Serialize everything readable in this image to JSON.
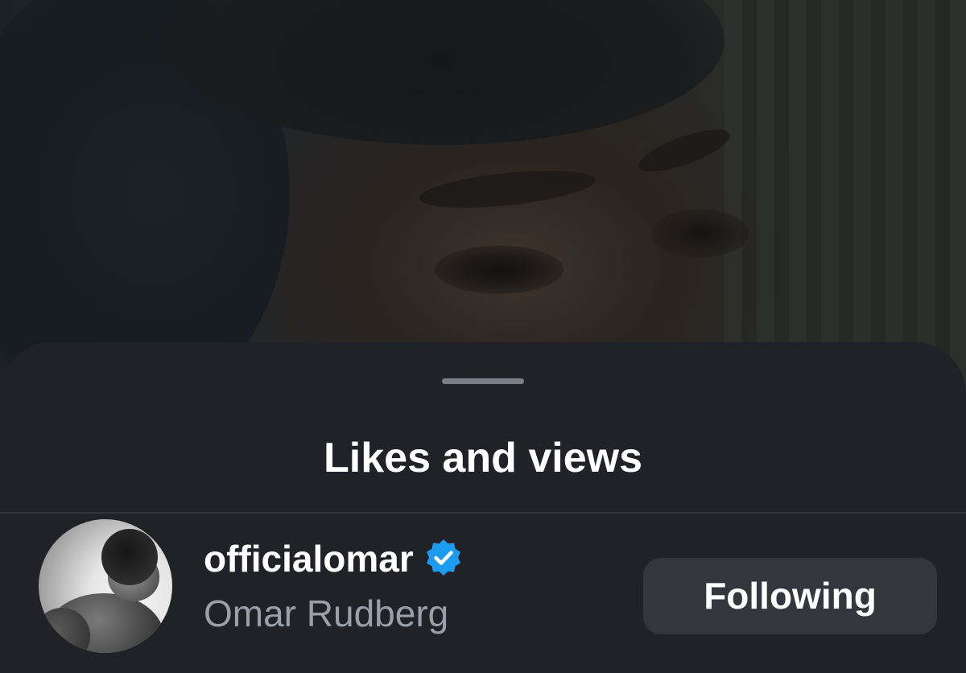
{
  "sheet": {
    "title": "Likes and views"
  },
  "viewer": {
    "username": "officialomar",
    "full_name": "Omar Rudberg",
    "verified": true,
    "follow_button_label": "Following",
    "avatar_icon": "profile-photo"
  },
  "colors": {
    "sheet_background": "#202227",
    "verified_badge": "#1d9bf0",
    "button_background": "#33363d",
    "secondary_text": "#9aa0a9"
  }
}
